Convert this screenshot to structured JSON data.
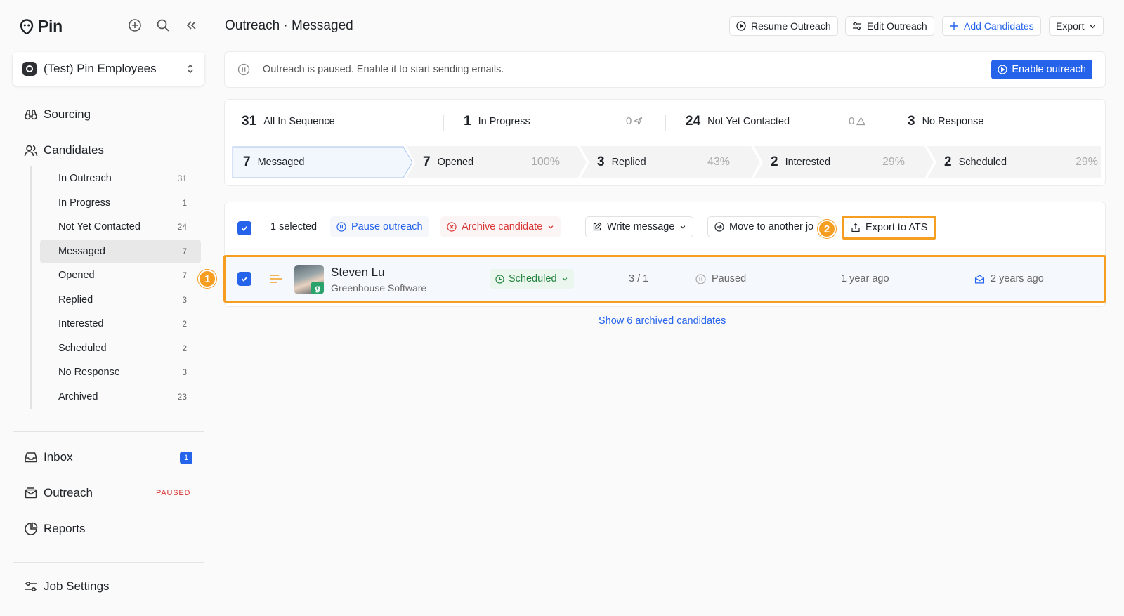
{
  "app": {
    "logo_text": "Pin"
  },
  "sidebar": {
    "workspace": "(Test) Pin Employees",
    "sourcing": "Sourcing",
    "candidates": "Candidates",
    "candidate_items": [
      {
        "label": "In Outreach",
        "count": "31"
      },
      {
        "label": "In Progress",
        "count": "1"
      },
      {
        "label": "Not Yet Contacted",
        "count": "24"
      },
      {
        "label": "Messaged",
        "count": "7"
      },
      {
        "label": "Opened",
        "count": "7"
      },
      {
        "label": "Replied",
        "count": "3"
      },
      {
        "label": "Interested",
        "count": "2"
      },
      {
        "label": "Scheduled",
        "count": "2"
      },
      {
        "label": "No Response",
        "count": "3"
      },
      {
        "label": "Archived",
        "count": "23"
      }
    ],
    "inbox": "Inbox",
    "inbox_badge": "1",
    "outreach": "Outreach",
    "outreach_tag": "PAUSED",
    "reports": "Reports",
    "job_settings": "Job Settings"
  },
  "header": {
    "title": "Outreach · Messaged",
    "resume_label": "Resume Outreach",
    "edit_label": "Edit Outreach",
    "add_label": "Add Candidates",
    "export_label": "Export"
  },
  "banner": {
    "text": "Outreach is paused. Enable it to start sending emails.",
    "button": "Enable outreach"
  },
  "stats": {
    "top": [
      {
        "num": "31",
        "label": "All In Sequence"
      },
      {
        "num": "1",
        "label": "In Progress",
        "side": "0"
      },
      {
        "num": "24",
        "label": "Not Yet Contacted",
        "side": "0"
      },
      {
        "num": "3",
        "label": "No Response"
      }
    ],
    "funnel": [
      {
        "num": "7",
        "label": "Messaged",
        "pct": ""
      },
      {
        "num": "7",
        "label": "Opened",
        "pct": "100%"
      },
      {
        "num": "3",
        "label": "Replied",
        "pct": "43%"
      },
      {
        "num": "2",
        "label": "Interested",
        "pct": "29%"
      },
      {
        "num": "2",
        "label": "Scheduled",
        "pct": "29%"
      }
    ]
  },
  "toolbar": {
    "selected": "1 selected",
    "pause": "Pause outreach",
    "archive": "Archive candidate",
    "write": "Write message",
    "move": "Move to another jo",
    "export_ats": "Export to ATS"
  },
  "row": {
    "name": "Steven Lu",
    "company": "Greenhouse Software",
    "ats_badge": "g",
    "status": "Scheduled",
    "steps": "3 / 1",
    "state": "Paused",
    "added": "1 year ago",
    "last_contact": "2 years ago"
  },
  "archived_link": "Show 6 archived candidates",
  "markers": {
    "one": "1",
    "two": "2"
  },
  "colors": {
    "accent": "#2563eb",
    "highlight": "#f59e22",
    "danger": "#d93535",
    "success": "#23843f"
  }
}
